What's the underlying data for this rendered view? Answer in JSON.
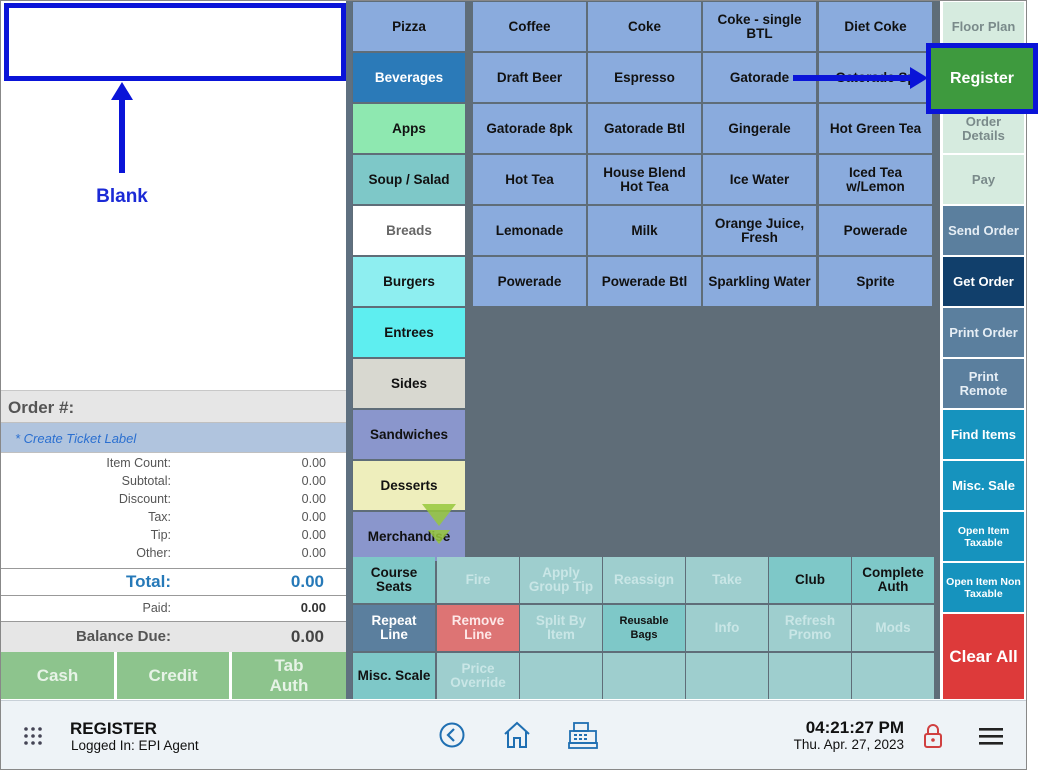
{
  "annotation": {
    "blank_label": "Blank"
  },
  "order": {
    "header": "Order #:",
    "ticket_label": "* Create Ticket Label",
    "summary": [
      {
        "label": "Item Count:",
        "value": "0.00"
      },
      {
        "label": "Subtotal:",
        "value": "0.00"
      },
      {
        "label": "Discount:",
        "value": "0.00"
      },
      {
        "label": "Tax:",
        "value": "0.00"
      },
      {
        "label": "Tip:",
        "value": "0.00"
      },
      {
        "label": "Other:",
        "value": "0.00"
      }
    ],
    "total_label": "Total:",
    "total_value": "0.00",
    "paid_label": "Paid:",
    "paid_value": "0.00",
    "balance_label": "Balance Due:",
    "balance_value": "0.00"
  },
  "payment": {
    "cash": "Cash",
    "credit": "Credit",
    "tab_auth": "Tab Auth"
  },
  "categories": [
    {
      "label": "Pizza",
      "color": "#8aabdd"
    },
    {
      "label": "Beverages",
      "color": "#2b7ab8"
    },
    {
      "label": "Apps",
      "color": "#8ee8b0"
    },
    {
      "label": "Soup / Salad",
      "color": "#7ec8c8"
    },
    {
      "label": "Breads",
      "color": "#ffffff"
    },
    {
      "label": "Burgers",
      "color": "#8eeef0"
    },
    {
      "label": "Entrees",
      "color": "#5eeef0"
    },
    {
      "label": "Sides",
      "color": "#d8d8d0"
    },
    {
      "label": "Sandwiches",
      "color": "#8a96cc"
    },
    {
      "label": "Desserts",
      "color": "#eeeebc"
    },
    {
      "label": "Merchandise",
      "color": "#8a96cc"
    }
  ],
  "items": [
    "Coffee",
    "Coke",
    "Coke - single BTL",
    "Diet Coke",
    "Draft Beer",
    "Espresso",
    "Gatorade",
    "Gatorade Sp",
    "Gatorade 8pk",
    "Gatorade Btl",
    "Gingerale",
    "Hot Green Tea",
    "Hot Tea",
    "House Blend Hot Tea",
    "Ice Water",
    "Iced Tea w/Lemon",
    "Lemonade",
    "Milk",
    "Orange Juice, Fresh",
    "Powerade",
    "Powerade",
    "Powerade Btl",
    "Sparkling Water",
    "Sprite"
  ],
  "actions": [
    {
      "label": "Course Seats",
      "enabled": true
    },
    {
      "label": "Fire",
      "enabled": false
    },
    {
      "label": "Apply Group Tip",
      "enabled": false
    },
    {
      "label": "Reassign",
      "enabled": false
    },
    {
      "label": "Take",
      "enabled": false
    },
    {
      "label": "Club",
      "enabled": true
    },
    {
      "label": "Complete Auth",
      "enabled": true
    },
    {
      "label": "Repeat Line",
      "enabled": true,
      "style": "slate"
    },
    {
      "label": "Remove Line",
      "enabled": true,
      "style": "red"
    },
    {
      "label": "Split By Item",
      "enabled": false
    },
    {
      "label": "Reusable Bags",
      "enabled": true
    },
    {
      "label": "Info",
      "enabled": false
    },
    {
      "label": "Refresh Promo",
      "enabled": false
    },
    {
      "label": "Mods",
      "enabled": false
    },
    {
      "label": "Misc. Scale",
      "enabled": true
    },
    {
      "label": "Price Override",
      "enabled": false
    },
    {
      "label": "",
      "enabled": false
    },
    {
      "label": "",
      "enabled": false
    },
    {
      "label": "",
      "enabled": false
    },
    {
      "label": "",
      "enabled": false
    },
    {
      "label": "",
      "enabled": false
    }
  ],
  "sidebar": [
    {
      "label": "Floor Plan",
      "style": "light"
    },
    {
      "label": "Register",
      "style": "green"
    },
    {
      "label": "Order Details",
      "style": "light"
    },
    {
      "label": "Pay",
      "style": "light"
    },
    {
      "label": "Send Order",
      "style": "slate"
    },
    {
      "label": "Get Order",
      "style": "navy"
    },
    {
      "label": "Print Order",
      "style": "slate"
    },
    {
      "label": "Print Remote",
      "style": "slate"
    },
    {
      "label": "Find Items",
      "style": "teal"
    },
    {
      "label": "Misc. Sale",
      "style": "teal"
    },
    {
      "label": "Open Item Taxable",
      "style": "teal-small"
    },
    {
      "label": "Open Item Non Taxable",
      "style": "teal-small"
    },
    {
      "label": "Clear All",
      "style": "red"
    }
  ],
  "statusbar": {
    "title": "REGISTER",
    "logged_in": "Logged In:  EPI Agent",
    "time": "04:21:27 PM",
    "date": "Thu. Apr. 27, 2023"
  }
}
